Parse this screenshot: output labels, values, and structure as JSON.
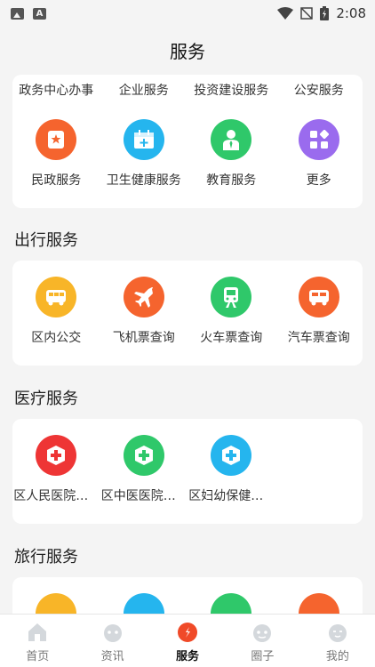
{
  "status": {
    "time": "2:08"
  },
  "page_title": "服务",
  "top_card": {
    "row1": [
      "政务中心办事",
      "企业服务",
      "投资建设服务",
      "公安服务"
    ],
    "row2": [
      {
        "label": "民政服务",
        "icon": "badge-icon",
        "color": "#f5642e"
      },
      {
        "label": "卫生健康服务",
        "icon": "calendar-plus-icon",
        "color": "#25b5ee"
      },
      {
        "label": "教育服务",
        "icon": "teacher-icon",
        "color": "#2fc86a"
      },
      {
        "label": "更多",
        "icon": "grid-more-icon",
        "color": "#9a6bee"
      }
    ]
  },
  "travel": {
    "title": "出行服务",
    "items": [
      {
        "label": "区内公交",
        "icon": "bus-icon",
        "color": "#f8b528"
      },
      {
        "label": "飞机票查询",
        "icon": "airplane-icon",
        "color": "#f5642e"
      },
      {
        "label": "火车票查询",
        "icon": "train-icon",
        "color": "#2fc86a"
      },
      {
        "label": "汽车票查询",
        "icon": "coach-icon",
        "color": "#f5642e"
      }
    ]
  },
  "medical": {
    "title": "医疗服务",
    "items": [
      {
        "label": "区人民医院预约挂号",
        "icon": "hospital-cross-icon",
        "color": "#ee3535"
      },
      {
        "label": "区中医医院预约挂号",
        "icon": "hospital-cross-icon",
        "color": "#2fc86a"
      },
      {
        "label": "区妇幼保健院预约挂号",
        "icon": "hospital-cross-icon",
        "color": "#25b5ee"
      }
    ]
  },
  "tourism": {
    "title": "旅行服务",
    "items": [
      {
        "icon": "building-icon",
        "color": "#f8b528"
      },
      {
        "icon": "ticket-icon",
        "color": "#25b5ee"
      },
      {
        "icon": "sun-icon",
        "color": "#2fc86a"
      },
      {
        "icon": "flag-icon",
        "color": "#f5642e"
      }
    ]
  },
  "tabs": [
    {
      "label": "首页",
      "icon": "home-icon",
      "active": false
    },
    {
      "label": "资讯",
      "icon": "news-icon",
      "active": false
    },
    {
      "label": "服务",
      "icon": "service-icon",
      "active": true
    },
    {
      "label": "圈子",
      "icon": "circle-icon",
      "active": false
    },
    {
      "label": "我的",
      "icon": "profile-icon",
      "active": false
    }
  ]
}
